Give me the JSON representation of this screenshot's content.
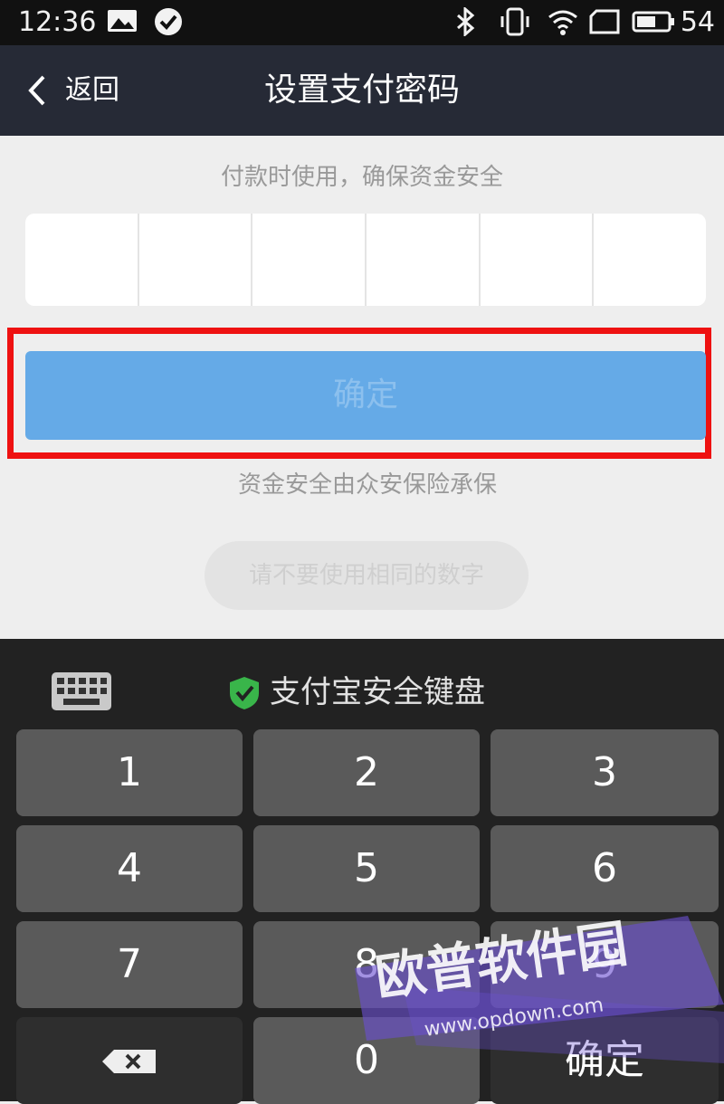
{
  "status_bar": {
    "time": "12:36",
    "battery": "54"
  },
  "nav": {
    "back_label": "返回",
    "title": "设置支付密码"
  },
  "form": {
    "hint": "付款时使用，确保资金安全",
    "confirm_label": "确定",
    "insurance_note": "资金安全由众安保险承保",
    "toast": "请不要使用相同的数字"
  },
  "keyboard": {
    "title": "支付宝安全键盘",
    "keys": [
      "1",
      "2",
      "3",
      "4",
      "5",
      "6",
      "7",
      "8",
      "9",
      "0"
    ],
    "confirm_label": "确定"
  },
  "watermark": {
    "title": "欧普软件园",
    "url": "www.opdown.com"
  },
  "colors": {
    "nav_bg": "#262a36",
    "confirm_button": "#65aae7",
    "highlight": "#ee1111",
    "keyboard_bg": "#222222",
    "key_bg": "#5a5a5a",
    "shield": "#39b54a"
  }
}
